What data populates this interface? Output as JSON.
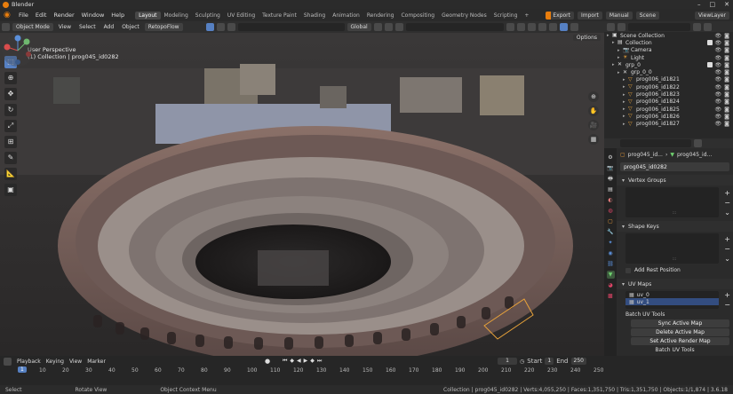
{
  "window": {
    "title": "Blender",
    "controls": [
      "–",
      "□",
      "✕"
    ]
  },
  "menu": {
    "items": [
      "File",
      "Edit",
      "Render",
      "Window",
      "Help"
    ],
    "workspaces": [
      "Layout",
      "Modeling",
      "Sculpting",
      "UV Editing",
      "Texture Paint",
      "Shading",
      "Animation",
      "Rendering",
      "Compositing",
      "Geometry Nodes",
      "Scripting",
      "+"
    ],
    "active_workspace": "Layout",
    "export": "Export",
    "import": "Import",
    "manual": "Manual",
    "scene": "Scene",
    "view_layer": "ViewLayer"
  },
  "viewport_header": {
    "mode": "Object Mode",
    "menus": [
      "View",
      "Select",
      "Add",
      "Object",
      "RetopoFlow"
    ],
    "transform": "Global",
    "options": "Options"
  },
  "viewport": {
    "perspective": "User Perspective",
    "collection_info": "(1) Collection | prog045_id0282"
  },
  "outliner": {
    "rows": [
      {
        "label": "Scene Collection",
        "icon": "scene-collection-icon",
        "indent": 0,
        "color": "#dddddd",
        "sel": false
      },
      {
        "label": "Collection",
        "icon": "collection-icon",
        "indent": 1,
        "color": "#dddddd",
        "sel": false
      },
      {
        "label": "Camera",
        "icon": "camera-icon",
        "indent": 2,
        "color": "#e8a23a",
        "sel": false
      },
      {
        "label": "Light",
        "icon": "light-icon",
        "indent": 2,
        "color": "#e8a23a",
        "sel": false
      },
      {
        "label": "grp_0",
        "icon": "empty-icon",
        "indent": 1,
        "color": "#dddddd",
        "sel": false
      },
      {
        "label": "grp_0_0",
        "icon": "empty-icon",
        "indent": 2,
        "color": "#dddddd",
        "sel": false
      },
      {
        "label": "prog006_id1821",
        "icon": "mesh-icon",
        "indent": 3,
        "color": "#e8a23a",
        "sel": false
      },
      {
        "label": "prog006_id1822",
        "icon": "mesh-icon",
        "indent": 3,
        "color": "#e8a23a",
        "sel": false
      },
      {
        "label": "prog006_id1823",
        "icon": "mesh-icon",
        "indent": 3,
        "color": "#e8a23a",
        "sel": false
      },
      {
        "label": "prog006_id1824",
        "icon": "mesh-icon",
        "indent": 3,
        "color": "#e8a23a",
        "sel": false
      },
      {
        "label": "prog006_id1825",
        "icon": "mesh-icon",
        "indent": 3,
        "color": "#e8a23a",
        "sel": false
      },
      {
        "label": "prog006_id1826",
        "icon": "mesh-icon",
        "indent": 3,
        "color": "#e8a23a",
        "sel": false
      },
      {
        "label": "prog006_id1827",
        "icon": "mesh-icon",
        "indent": 3,
        "color": "#e8a23a",
        "sel": false
      }
    ]
  },
  "properties": {
    "breadcrumb_object": "prog045_id...",
    "breadcrumb_mesh": "prog045_id...",
    "mesh_name": "prog045_id0282",
    "panels": {
      "vertex_groups": "Vertex Groups",
      "shape_keys": "Shape Keys",
      "add_rest_position": "Add Rest Position",
      "uv_maps": "UV Maps"
    },
    "uv_maps": [
      "uv_0",
      "uv_1"
    ],
    "batch_uv_tools": "Batch UV Tools",
    "buttons": [
      "Sync Active Map",
      "Delete Active Map",
      "Set Active Render Map"
    ],
    "batch_uv_tools_footer": "Batch UV Tools"
  },
  "timeline": {
    "menus": [
      "Playback",
      "Keying",
      "View",
      "Marker"
    ],
    "ticks": [
      "10",
      "20",
      "30",
      "40",
      "50",
      "60",
      "70",
      "80",
      "90",
      "100",
      "110",
      "120",
      "130",
      "140",
      "150",
      "160",
      "170",
      "180",
      "190",
      "200",
      "210",
      "220",
      "230",
      "240",
      "250"
    ],
    "current_frame": "1",
    "frame_field": "1",
    "start_label": "Start",
    "start": "1",
    "end_label": "End",
    "end": "250"
  },
  "statusbar": {
    "select": "Select",
    "rotate": "Rotate View",
    "context": "Object Context Menu",
    "stats": "Collection | prog045_id0282 | Verts:4,055,250 | Faces:1,351,750 | Tris:1,351,750 | Objects:1/1,874 | 3.6.18"
  }
}
